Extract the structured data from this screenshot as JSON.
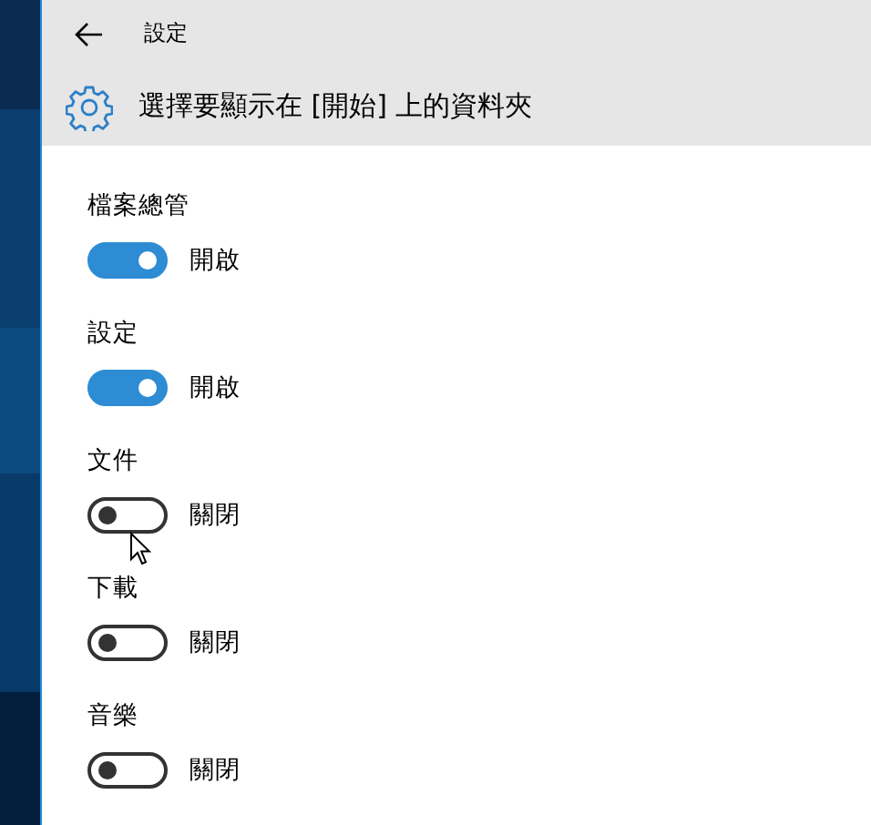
{
  "window": {
    "title": "設定"
  },
  "header": {
    "title": "選擇要顯示在 [開始] 上的資料夾"
  },
  "folders": [
    {
      "label": "檔案總管",
      "on": true,
      "state_text": "開啟"
    },
    {
      "label": "設定",
      "on": true,
      "state_text": "開啟"
    },
    {
      "label": "文件",
      "on": false,
      "state_text": "關閉"
    },
    {
      "label": "下載",
      "on": false,
      "state_text": "關閉"
    },
    {
      "label": "音樂",
      "on": false,
      "state_text": "關閉"
    }
  ]
}
